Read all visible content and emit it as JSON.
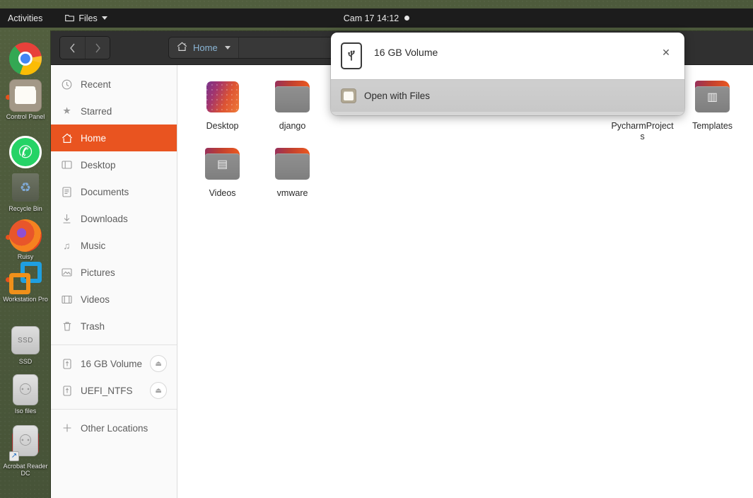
{
  "topbar": {
    "activities": "Activities",
    "app_name": "Files",
    "app_icon": "folder-icon",
    "caret_icon": "chevron-down-icon",
    "clock": "Cam 17  14:12",
    "notification_dot": "notification-dot"
  },
  "desktop_icons": [
    {
      "label": "",
      "icon": "google-chrome-icon",
      "selected": false
    },
    {
      "label": "Control Panel",
      "icon": "folder-icon",
      "selected": true
    },
    {
      "label": "",
      "icon": "whatsapp-icon",
      "selected": false
    },
    {
      "label": "Recycle Bin",
      "icon": "recycle-bin-icon",
      "selected": false
    },
    {
      "label": "Ruisy",
      "icon": "firefox-icon",
      "selected": true
    },
    {
      "label": "Workstation Pro",
      "icon": "vmware-icon",
      "selected": true
    },
    {
      "label": "SSD",
      "icon": "hard-drive-icon",
      "selected": false
    },
    {
      "label": "Iso files",
      "icon": "usb-drive-icon",
      "selected": false
    },
    {
      "label": "Acrobat Reader DC",
      "icon": "usb-drive-icon",
      "selected": false
    }
  ],
  "window": {
    "headerbar": {
      "back_icon": "chevron-left-icon",
      "forward_icon": "chevron-right-icon",
      "path_label": "Home",
      "path_home_icon": "home-icon",
      "path_caret_icon": "chevron-down-icon"
    },
    "sidebar": {
      "items": [
        {
          "label": "Recent",
          "icon": "clock-icon",
          "active": false,
          "eject": false
        },
        {
          "label": "Starred",
          "icon": "star-icon",
          "active": false,
          "eject": false
        },
        {
          "label": "Home",
          "icon": "home-icon",
          "active": true,
          "eject": false
        },
        {
          "label": "Desktop",
          "icon": "desktop-icon",
          "active": false,
          "eject": false
        },
        {
          "label": "Documents",
          "icon": "document-icon",
          "active": false,
          "eject": false
        },
        {
          "label": "Downloads",
          "icon": "download-icon",
          "active": false,
          "eject": false
        },
        {
          "label": "Music",
          "icon": "music-icon",
          "active": false,
          "eject": false
        },
        {
          "label": "Pictures",
          "icon": "image-icon",
          "active": false,
          "eject": false
        },
        {
          "label": "Videos",
          "icon": "video-icon",
          "active": false,
          "eject": false
        },
        {
          "label": "Trash",
          "icon": "trash-icon",
          "active": false,
          "eject": false
        },
        {
          "separator": true
        },
        {
          "label": "16 GB Volume",
          "icon": "usb-drive-icon",
          "active": false,
          "eject": true
        },
        {
          "label": "UEFI_NTFS",
          "icon": "usb-drive-icon",
          "active": false,
          "eject": true
        },
        {
          "separator": true
        },
        {
          "label": "Other Locations",
          "icon": "plus-icon",
          "active": false,
          "eject": false
        }
      ],
      "eject_icon": "eject-icon"
    },
    "files": [
      {
        "name": "Desktop",
        "icon": "desktop-wallpaper-thumbnail",
        "emblem": ""
      },
      {
        "name": "django",
        "icon": "folder-icon",
        "emblem": ""
      },
      {
        "name": "",
        "icon": "hidden-placeholder",
        "emblem": ""
      },
      {
        "name": "",
        "icon": "hidden-placeholder",
        "emblem": ""
      },
      {
        "name": "",
        "icon": "hidden-placeholder",
        "emblem": ""
      },
      {
        "name": "",
        "icon": "hidden-placeholder",
        "emblem": ""
      },
      {
        "name": "PycharmProjects",
        "icon": "folder-icon",
        "emblem": ""
      },
      {
        "name": "Templates",
        "icon": "folder-icon",
        "emblem": "▥"
      },
      {
        "name": "Videos",
        "icon": "folder-icon",
        "emblem": "▤"
      },
      {
        "name": "vmware",
        "icon": "folder-icon",
        "emblem": ""
      }
    ]
  },
  "notification": {
    "device_icon": "usb-drive-icon",
    "title": "16 GB Volume",
    "close_icon": "close-icon",
    "action_label": "Open with Files",
    "action_icon": "folder-icon"
  },
  "colors": {
    "accent": "#e95420",
    "topbar_bg": "#1c1c1c",
    "headerbar_bg": "#303030",
    "sidebar_bg": "#fafafa",
    "folder_tab_start": "#96305c",
    "folder_tab_end": "#ef5a1e"
  }
}
